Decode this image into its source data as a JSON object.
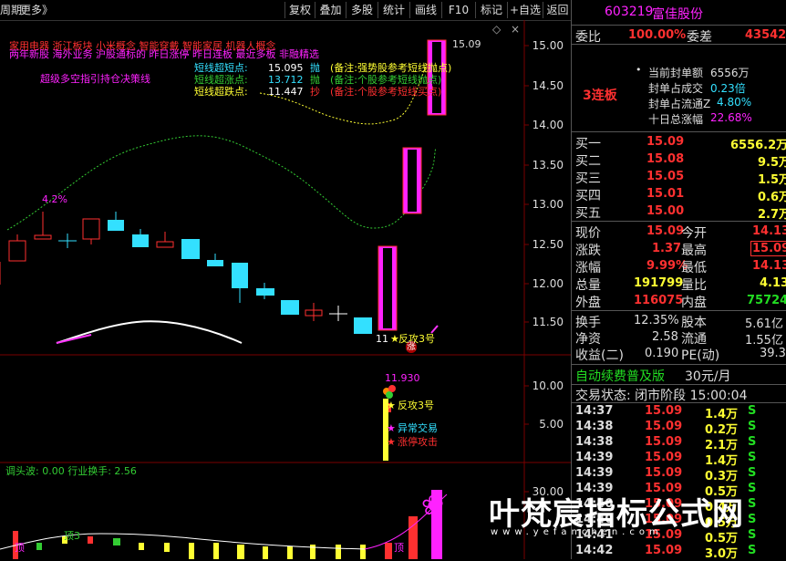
{
  "toolbar": {
    "left_label": "周期",
    "more": "更多》",
    "tabs": [
      "复权",
      "叠加",
      "多股",
      "统计",
      "画线",
      "F10",
      "标记",
      "+自选",
      "返回"
    ]
  },
  "chart": {
    "price_axis": [
      "15.00",
      "14.50",
      "14.00",
      "13.50",
      "13.00",
      "12.50",
      "12.00",
      "11.50"
    ],
    "sub_axis": [
      "10.00",
      "5.00"
    ],
    "vol_axis": [
      "30.00"
    ],
    "concepts_line1": "家用电器  浙江板块  小米概念 智能穿戴 智能家居 机器人概念",
    "concepts_line2": "两年新股 海外业务 沪股通标的 昨日涨停 昨日连板 最近多板 非融精选",
    "signals": [
      {
        "name": "短线超短点:",
        "value": "15.095",
        "act": "抛",
        "note": "(备注:强势股参考短线抛点)"
      },
      {
        "name": "短线超涨点:",
        "value": "13.712",
        "act": "抛",
        "note": "(备注:个股参考短线抛点)"
      },
      {
        "name": "短线超跌点:",
        "value": "11.447",
        "act": "抄",
        "note": "(备注:个股参考短线买点)"
      }
    ],
    "strategy_text": "超级多空指引持仓决策线",
    "pct_label": "4.2%",
    "high_label": "15.09",
    "low_label": "11",
    "fangong_label": "反攻3号",
    "zhang_label": "涨",
    "sub_peak": "11.930",
    "sub_tags": [
      "反攻3号",
      "异常交易",
      "涨停攻击"
    ],
    "bottom_status": "调头波: 0.00  行业换手: 2.56",
    "bottom_left_tag": "顶3",
    "bottom_left_mark": "顶",
    "bottom_right_mark": "顶"
  },
  "panel": {
    "code": "603219",
    "name": "富佳股份",
    "weibi_label": "委比",
    "weibi_value": "100.00%",
    "weicha_label": "委差",
    "weicha_value": "43542",
    "board_label": "3连板",
    "seal_rows": [
      {
        "label": "当前封单额",
        "value": "6556万"
      },
      {
        "label": "封单占成交",
        "value": "0.23倍"
      },
      {
        "label": "封单占流通Z",
        "value": "4.80%"
      },
      {
        "label": "十日总涨幅",
        "value": "22.68%"
      }
    ],
    "bids": [
      {
        "label": "买一",
        "price": "15.09",
        "vol": "6556.2万"
      },
      {
        "label": "买二",
        "price": "15.08",
        "vol": "9.5万"
      },
      {
        "label": "买三",
        "price": "15.05",
        "vol": "1.5万"
      },
      {
        "label": "买四",
        "price": "15.01",
        "vol": "0.6万"
      },
      {
        "label": "买五",
        "price": "15.00",
        "vol": "2.7万"
      }
    ],
    "quote": [
      {
        "l1": "现价",
        "v1": "15.09",
        "l2": "今开",
        "v2": "14.13"
      },
      {
        "l1": "涨跌",
        "v1": "1.37",
        "l2": "最高",
        "v2": "15.09"
      },
      {
        "l1": "涨幅",
        "v1": "9.99%",
        "l2": "最低",
        "v2": "14.13"
      },
      {
        "l1": "总量",
        "v1": "191799",
        "l2": "量比",
        "v2": "4.13"
      },
      {
        "l1": "外盘",
        "v1": "116075",
        "l2": "内盘",
        "v2": "75724"
      }
    ],
    "fin": [
      {
        "l1": "换手",
        "v1": "12.35%",
        "l2": "股本",
        "v2": "5.61亿"
      },
      {
        "l1": "净资",
        "v1": "2.58",
        "l2": "流通",
        "v2": "1.55亿"
      },
      {
        "l1": "收益(二)",
        "v1": "0.190",
        "l2": "PE(动)",
        "v2": "39.3"
      }
    ],
    "ad_text": "自动续费普及版",
    "ad_price": "30元/月",
    "trade_status": "交易状态: 闭市阶段 15:00:04",
    "ticks": [
      {
        "t": "14:37",
        "p": "15.09",
        "v": "1.4万",
        "s": "S"
      },
      {
        "t": "14:38",
        "p": "15.09",
        "v": "0.2万",
        "s": "S"
      },
      {
        "t": "14:38",
        "p": "15.09",
        "v": "2.1万",
        "s": "S"
      },
      {
        "t": "14:39",
        "p": "15.09",
        "v": "1.4万",
        "s": "S"
      },
      {
        "t": "14:39",
        "p": "15.09",
        "v": "0.3万",
        "s": "S"
      },
      {
        "t": "14:39",
        "p": "15.09",
        "v": "0.5万",
        "s": "S"
      },
      {
        "t": "14:40",
        "p": "15.09",
        "v": "0.4万",
        "s": "S"
      },
      {
        "t": "14:40",
        "p": "15.09",
        "v": "0.5万",
        "s": "S"
      },
      {
        "t": "14:41",
        "p": "15.09",
        "v": "0.5万",
        "s": "S"
      },
      {
        "t": "14:42",
        "p": "15.09",
        "v": "3.0万",
        "s": "S"
      }
    ]
  },
  "watermark": {
    "text": "叶梵宸指标公式网",
    "sub": "www.yefanchen.com"
  },
  "colors": {
    "up": "#ff3030",
    "down": "#33e0ff",
    "limit": "#ff22ff",
    "price": "#ffff33",
    "vol": "#22dd22"
  }
}
